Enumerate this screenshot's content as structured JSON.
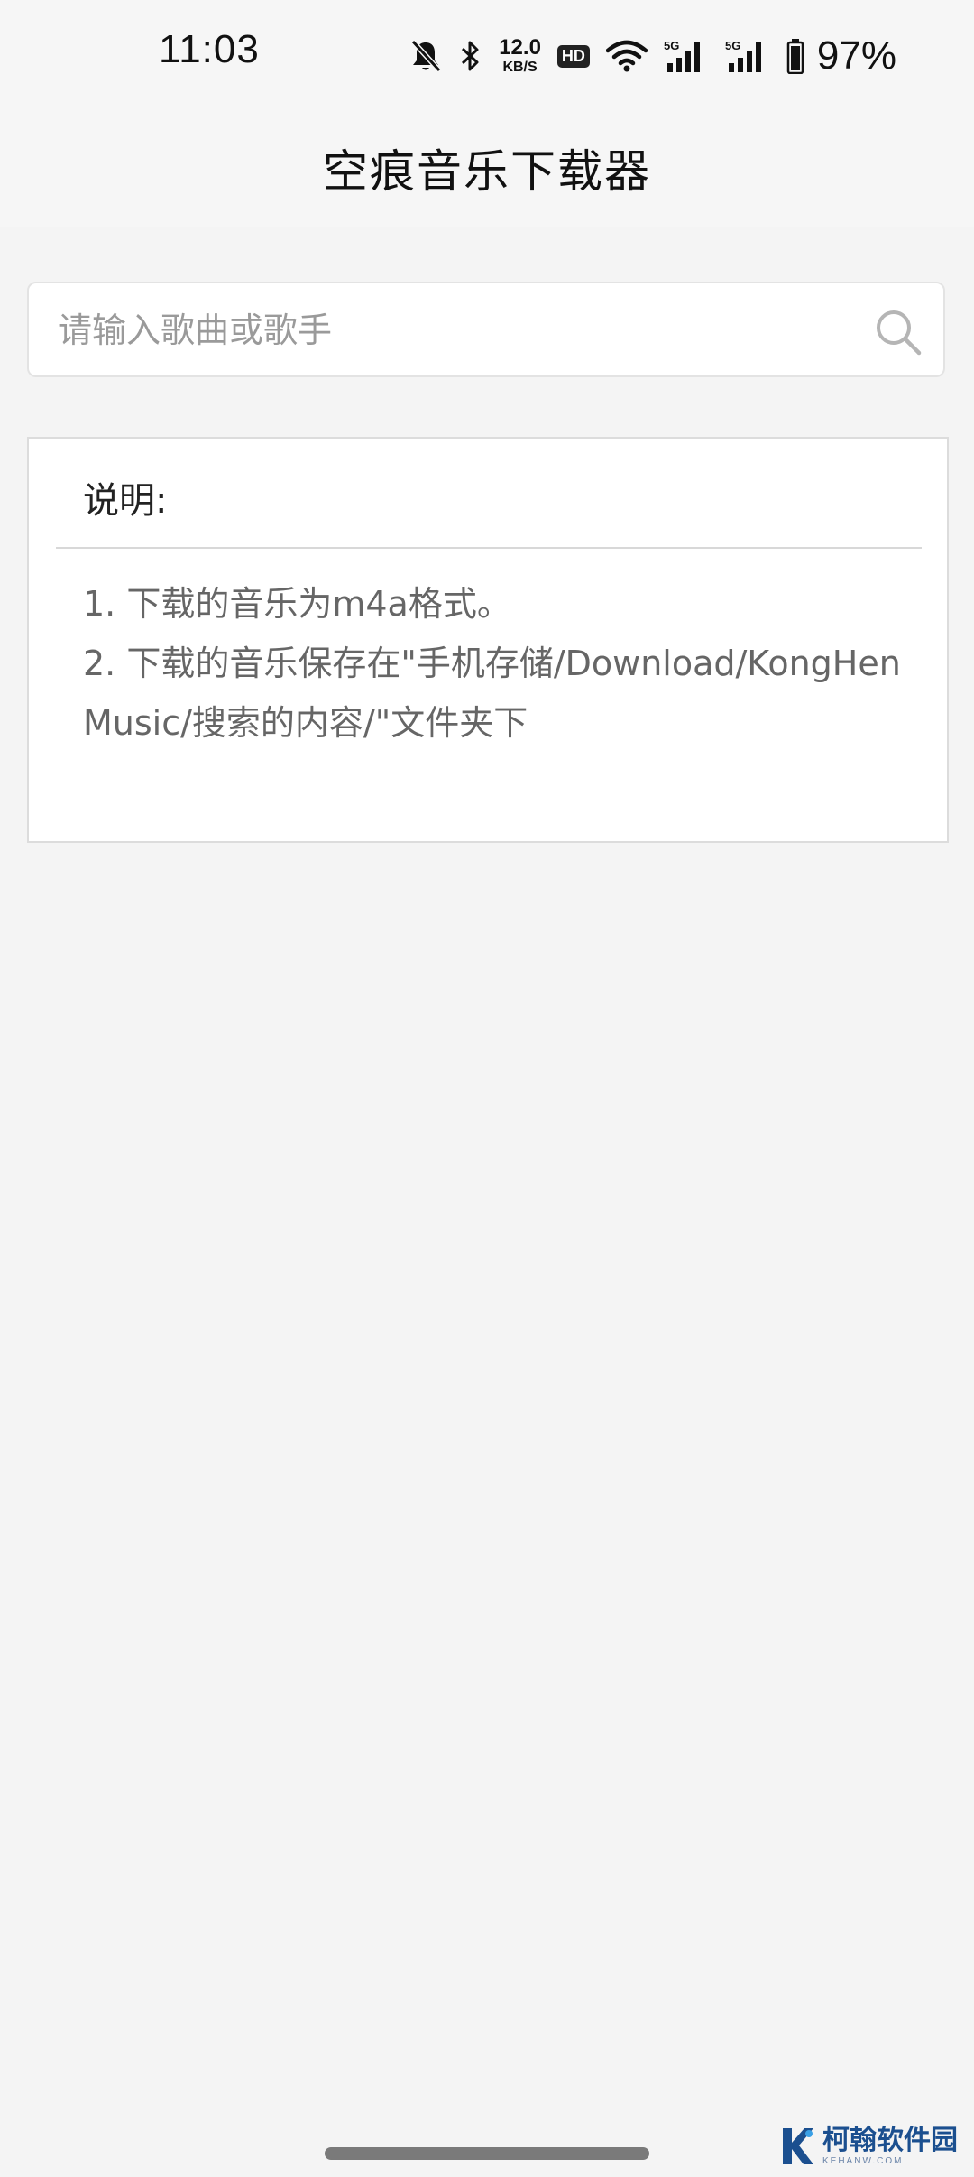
{
  "status_bar": {
    "time": "11:03",
    "net_speed_value": "12.0",
    "net_speed_unit": "KB/S",
    "hd_label": "HD",
    "signal_1_label": "5G",
    "signal_2_label": "5G",
    "battery_percent": "97%"
  },
  "app_bar": {
    "title": "空痕音乐下载器"
  },
  "search": {
    "placeholder": "请输入歌曲或歌手",
    "value": ""
  },
  "description": {
    "title": "说明:",
    "lines": [
      "1. 下载的音乐为m4a格式。",
      "2. 下载的音乐保存在\"手机存储/Download/KongHenMusic/搜索的内容/\"文件夹下"
    ]
  },
  "watermark": {
    "name_cn": "柯翰软件园",
    "name_en": "KEHANW.COM"
  },
  "colors": {
    "background": "#f4f4f4",
    "card_background": "#ffffff",
    "body_text": "#666666",
    "watermark_blue": "#1b4f8f"
  }
}
